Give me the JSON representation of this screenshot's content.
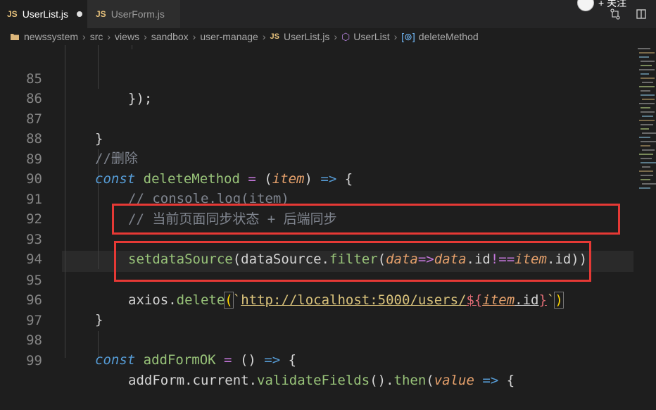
{
  "tabs": [
    {
      "js": "JS",
      "label": "UserList.js",
      "active": true,
      "dirty": true
    },
    {
      "js": "JS",
      "label": "UserForm.js",
      "active": false,
      "dirty": false
    }
  ],
  "header": {
    "follow_label": "+ 关注"
  },
  "breadcrumb": {
    "items": [
      "newssystem",
      "src",
      "views",
      "sandbox",
      "user-manage"
    ],
    "file_badge": "JS",
    "file": "UserList.js",
    "component": "UserList",
    "method": "deleteMethod"
  },
  "editor": {
    "line_numbers": [
      "85",
      "86",
      "87",
      "88",
      "89",
      "90",
      "91",
      "92",
      "93",
      "94",
      "95",
      "96",
      "97",
      "98",
      "99"
    ],
    "tokens": {
      "l85": "});",
      "l87": "}",
      "l88": "//删除",
      "l89_const": "const",
      "l89_name": "deleteMethod",
      "l89_eq": " = ",
      "l89_open": "(",
      "l89_param": "item",
      "l89_close": ") ",
      "l89_arrow": "=>",
      "l89_brace": " {",
      "l90": "// console.log(item)",
      "l91": "// 当前页面同步状态 + 后端同步",
      "l93_fn": "setdataSource",
      "l93_a": "(dataSource.",
      "l93_filter": "filter",
      "l93_b": "(",
      "l93_data1": "data",
      "l93_arrow": "=>",
      "l93_data2": "data",
      "l93_c": ".id",
      "l93_ne": "!==",
      "l93_item": "item",
      "l93_d": ".id))",
      "l95_axios": "axios.",
      "l95_delete": "delete",
      "l95_open": "(",
      "l95_tick": "`",
      "l95_url": "http://localhost:5000/users/",
      "l95_interp_open": "${",
      "l95_item": "item",
      "l95_id": ".id",
      "l95_interp_close": "}",
      "l95_tick2": "`",
      "l95_close": ")",
      "l96": "}",
      "l98_const": "const",
      "l98_name": "addFormOK",
      "l98_eq": " = ",
      "l98_rest": "() ",
      "l98_arrow": "=>",
      "l98_brace": " {",
      "l99_a": "addForm.current.",
      "l99_vf": "validateFields",
      "l99_b": "().",
      "l99_then": "then",
      "l99_c": "(",
      "l99_value": "value",
      "l99_arrow": " =>",
      "l99_d": " {"
    }
  },
  "colors": {
    "highlight_box": "#e53935",
    "background": "#1e1e1e"
  }
}
